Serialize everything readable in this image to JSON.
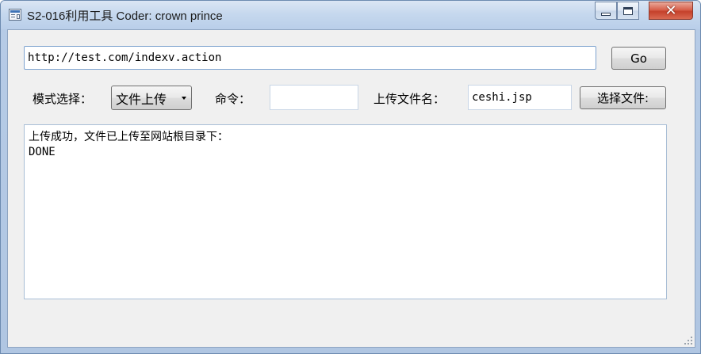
{
  "window": {
    "title": "S2-016利用工具 Coder: crown prince"
  },
  "form": {
    "url_value": "http://test.com/indexv.action",
    "go_label": "Go",
    "mode_label": "模式选择：",
    "mode_selected": "文件上传",
    "command_label": "命令：",
    "command_value": "",
    "upload_filename_label": "上传文件名：",
    "upload_filename_value": "ceshi.jsp",
    "choose_file_label": "选择文件:"
  },
  "output": {
    "lines": [
      "上传成功，文件已上传至网站根目录下：",
      "DONE"
    ]
  },
  "colors": {
    "titlebar": "#c6d8ee",
    "client_bg": "#f0f0f0",
    "close_button": "#c5412b",
    "input_border": "#7ea3cf"
  },
  "icons": [
    "app-icon",
    "minimize-icon",
    "maximize-icon",
    "close-icon",
    "resize-grip-icon",
    "dropdown-arrow-icon"
  ]
}
